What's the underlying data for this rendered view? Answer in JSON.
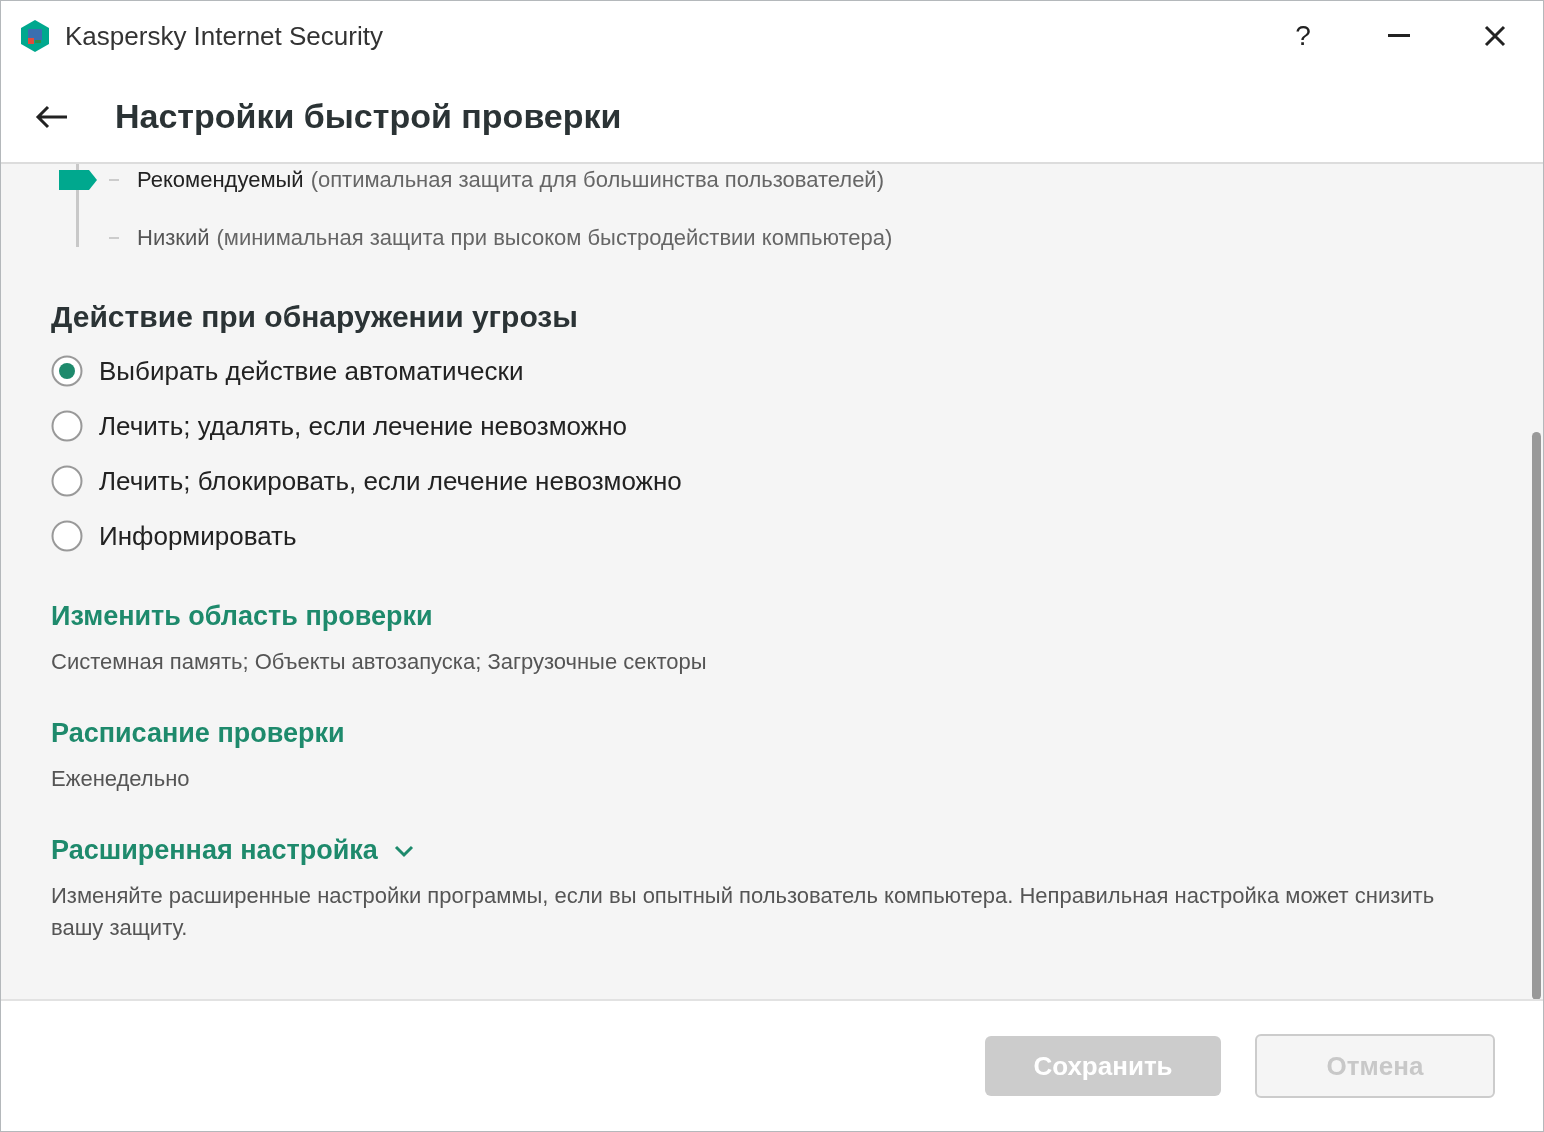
{
  "window": {
    "title": "Kaspersky Internet Security",
    "help_button": "?"
  },
  "page": {
    "title": "Настройки быстрой проверки"
  },
  "security_levels": [
    {
      "name": "Рекомендуемый",
      "note": "(оптимальная защита для большинства пользователей)",
      "selected": true
    },
    {
      "name": "Низкий",
      "note": "(минимальная защита при высоком быстродействии компьютера)",
      "selected": false
    }
  ],
  "threat_action": {
    "heading": "Действие при обнаружении угрозы",
    "options": [
      {
        "label": "Выбирать действие автоматически",
        "selected": true
      },
      {
        "label": "Лечить; удалять, если лечение невозможно",
        "selected": false
      },
      {
        "label": "Лечить; блокировать, если лечение невозможно",
        "selected": false
      },
      {
        "label": "Информировать",
        "selected": false
      }
    ]
  },
  "sections": [
    {
      "kind": "link",
      "title": "Изменить область проверки",
      "description": "Системная память; Объекты автозапуска; Загрузочные секторы"
    },
    {
      "kind": "link",
      "title": "Расписание проверки",
      "description": "Еженедельно"
    },
    {
      "kind": "expander",
      "title": "Расширенная настройка",
      "expanded": false,
      "description": "Изменяйте расширенные настройки программы, если вы опытный пользователь компьютера. Неправильная настройка может снизить вашу защиту."
    }
  ],
  "buttons": [
    {
      "kind": "primary",
      "label": "Сохранить",
      "disabled": true
    },
    {
      "kind": "secondary",
      "label": "Отмена",
      "disabled": true
    }
  ]
}
